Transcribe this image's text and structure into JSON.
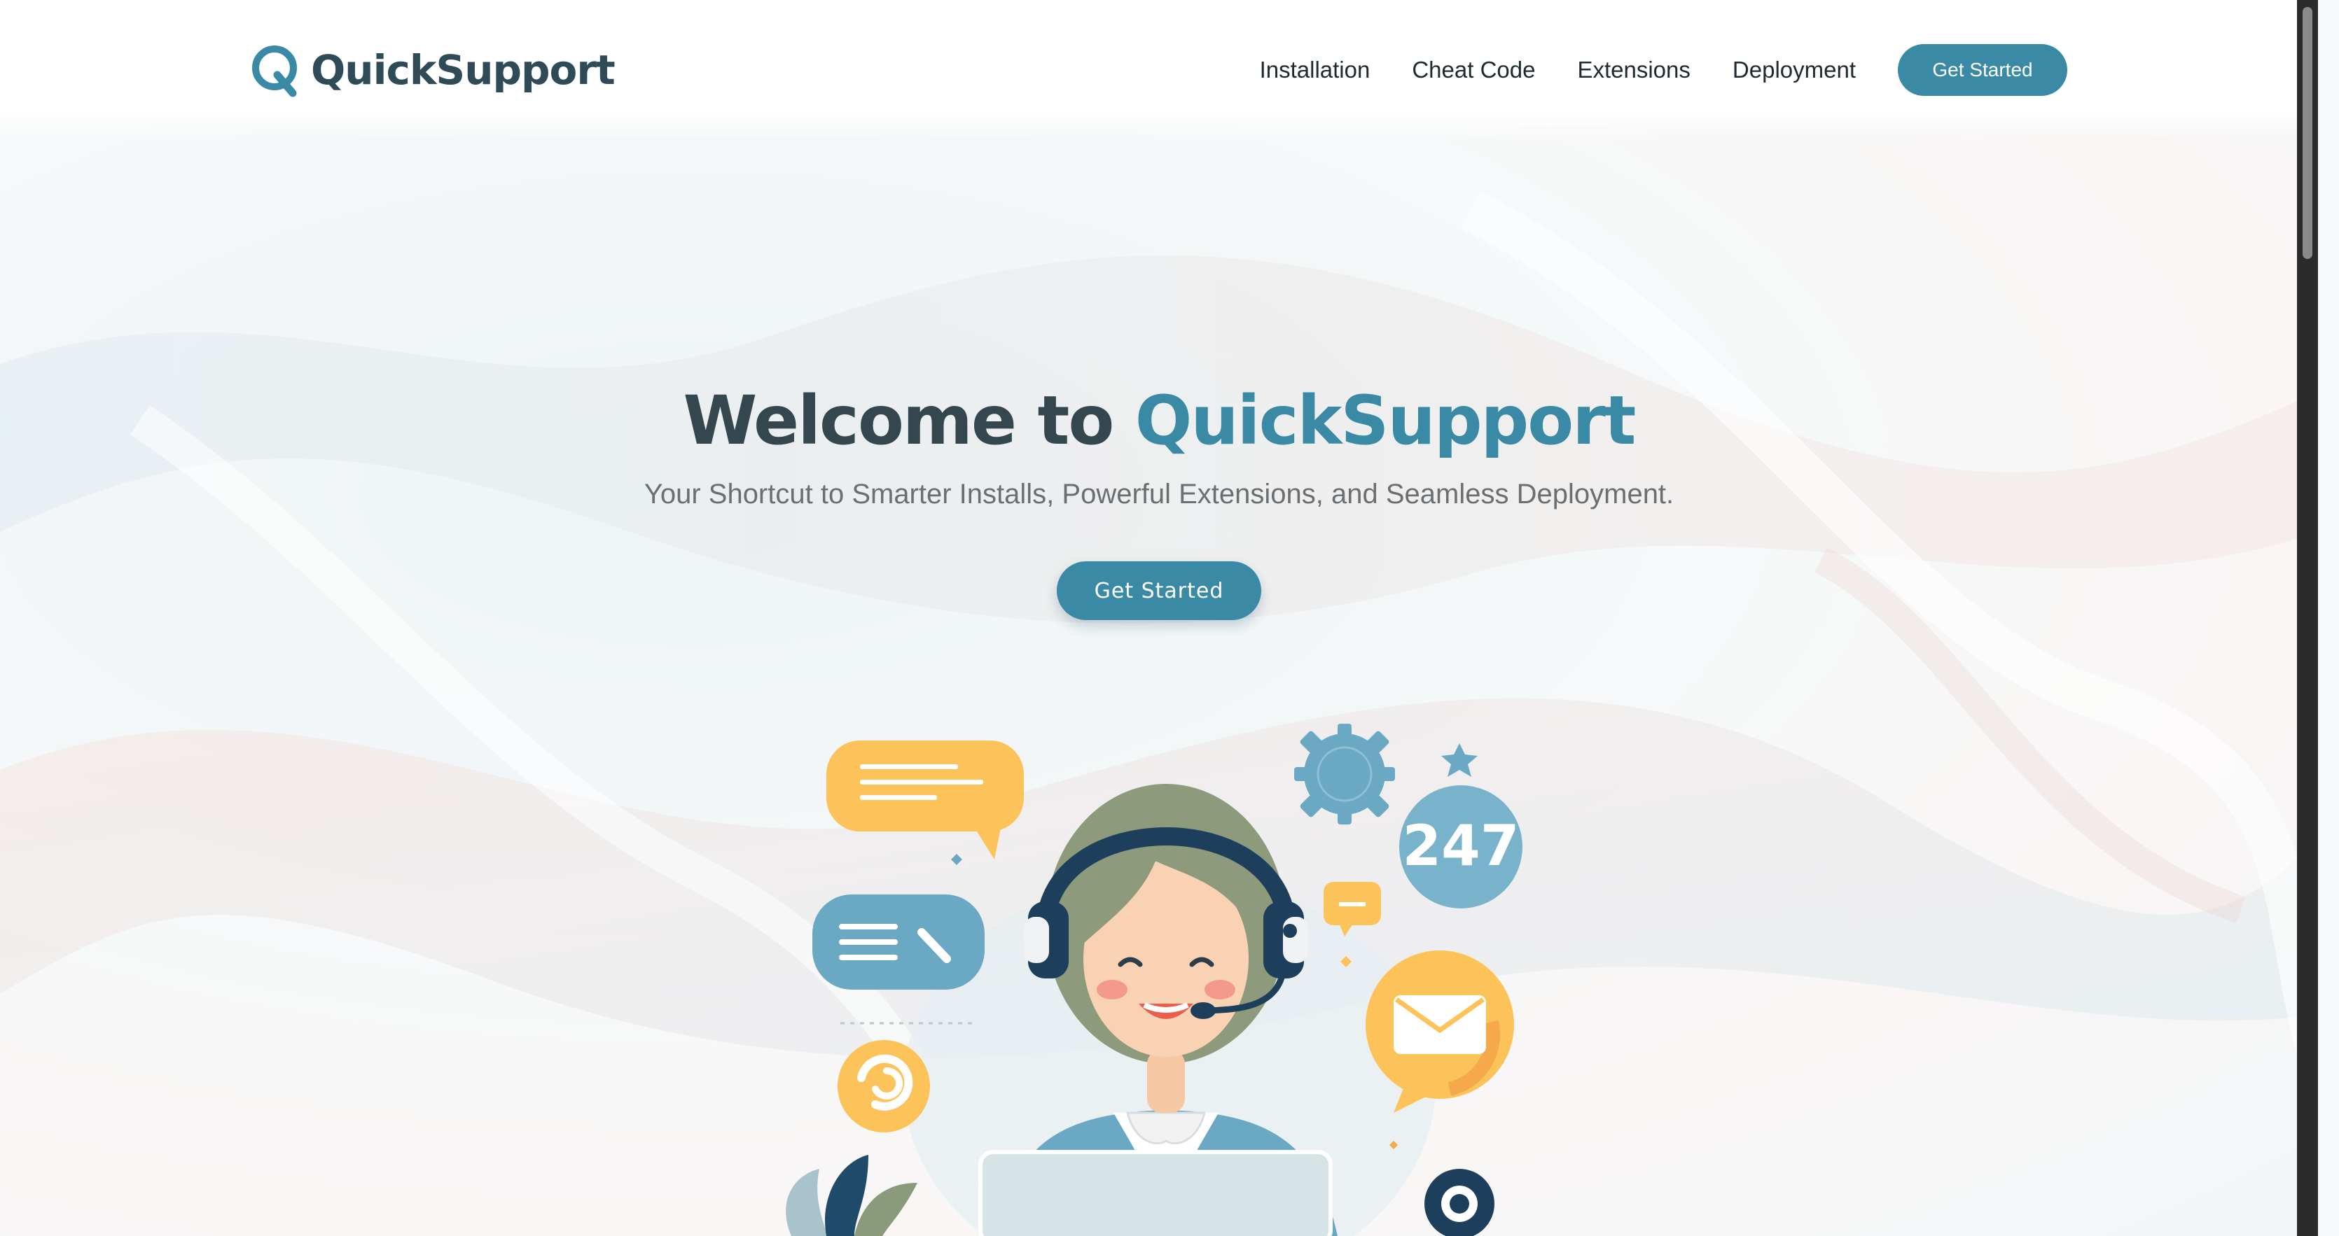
{
  "brand": {
    "name": "QuickSupport",
    "logo_icon": "q-logo-icon",
    "primary_color": "#3b8aa5",
    "text_color": "#34474f"
  },
  "nav": {
    "links": [
      "Installation",
      "Cheat Code",
      "Extensions",
      "Deployment"
    ],
    "cta_label": "Get Started"
  },
  "hero": {
    "title_prefix": "Welcome to ",
    "title_accent": "QuickSupport",
    "subtitle": "Your Shortcut to Smarter Installs, Powerful Extensions, and Seamless Deployment.",
    "cta_label": "Get Started",
    "illustration": {
      "badge_247": "247",
      "icons": [
        "chat-bubble-icon",
        "settings-gear-icon",
        "star-icon",
        "support-agent-illustration",
        "mail-icon",
        "refresh-icon",
        "gear-icon"
      ]
    }
  }
}
